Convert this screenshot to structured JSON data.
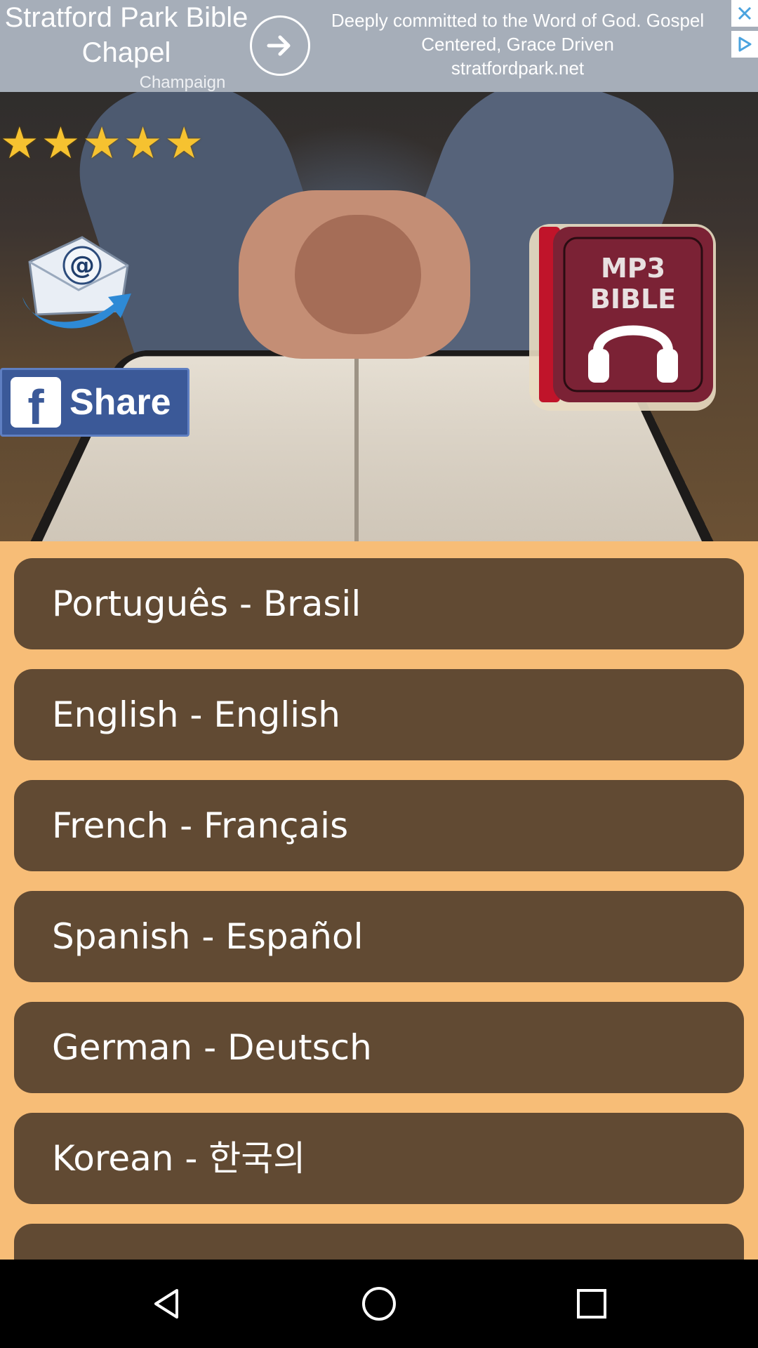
{
  "ad": {
    "title": "Stratford Park Bible Chapel",
    "subtitle": "Champaign",
    "description": "Deeply committed to the Word of God. Gospel Centered, Grace Driven",
    "url": "stratfordpark.net",
    "icons": [
      "arrow-right-icon",
      "close-icon",
      "adchoices-icon"
    ]
  },
  "hero": {
    "rating": 5,
    "stars": [
      "★",
      "★",
      "★",
      "★",
      "★"
    ],
    "share_label": "Share",
    "fb_logo": "f",
    "mp3_line1": "MP3",
    "mp3_line2": "BIBLE",
    "icons": [
      "star-icon",
      "email-icon",
      "facebook-icon",
      "headphones-icon"
    ]
  },
  "languages": [
    "Português - Brasil",
    "English - English",
    "French - Français",
    "Spanish - Español",
    "German - Deutsch",
    "Korean - 한국의",
    ""
  ],
  "colors": {
    "list_background": "#f7bd77",
    "button": "#614a33",
    "ad_background": "#a6aeb9",
    "star": "#f6c230",
    "facebook": "#3b5998",
    "mp3_book": "#7b2235"
  },
  "navbar": {
    "icons": [
      "back-icon",
      "home-icon",
      "recents-icon"
    ]
  }
}
